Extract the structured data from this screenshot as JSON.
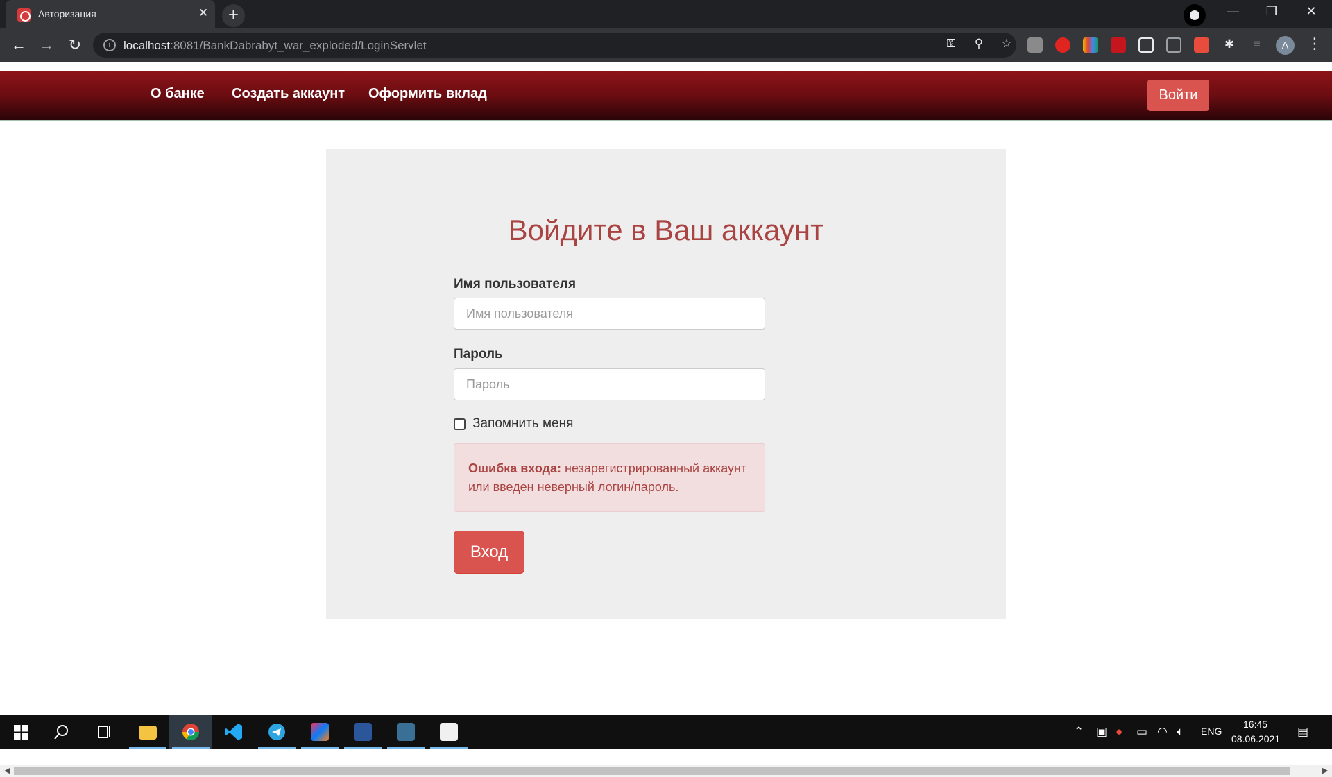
{
  "browser": {
    "tab_title": "Авторизация",
    "tab_close": "✕",
    "new_tab": "+",
    "url_host": "localhost",
    "url_rest": ":8081/BankDabrabyt_war_exploded/LoginServlet",
    "avatar_letter": "A",
    "icons": [
      "back-arrow-icon",
      "forward-arrow-icon",
      "reload-icon",
      "info-icon",
      "key-icon",
      "zoom-icon",
      "star-icon",
      "extensions-icon",
      "reading-list-icon",
      "menu-dots-icon"
    ]
  },
  "navbar": {
    "links": [
      "О банке",
      "Создать аккаунт",
      "Оформить вклад"
    ],
    "login_button": "Войти",
    "gradient_top": "#8d1418",
    "gradient_bottom": "#2a0407"
  },
  "form": {
    "heading": "Войдите в Ваш аккаунт",
    "username_label": "Имя пользователя",
    "username_placeholder": "Имя пользователя",
    "password_label": "Пароль",
    "password_placeholder": "Пароль",
    "remember_label": "Запомнить меня",
    "error_title": "Ошибка входа:",
    "error_text": " незарегистрированный аккаунт или введен неверный логин/пароль.",
    "submit_label": "Вход",
    "accent_color": "#d9534f",
    "error_color": "#a94442"
  },
  "taskbar": {
    "language": "ENG",
    "time": "16:45",
    "date": "08.06.2021",
    "apps": [
      "windows-start-icon",
      "search-icon",
      "task-view-icon",
      "file-explorer-icon",
      "chrome-icon",
      "vscode-icon",
      "telegram-icon",
      "intellij-icon",
      "word-icon",
      "mysql-workbench-icon",
      "java-icon"
    ]
  }
}
